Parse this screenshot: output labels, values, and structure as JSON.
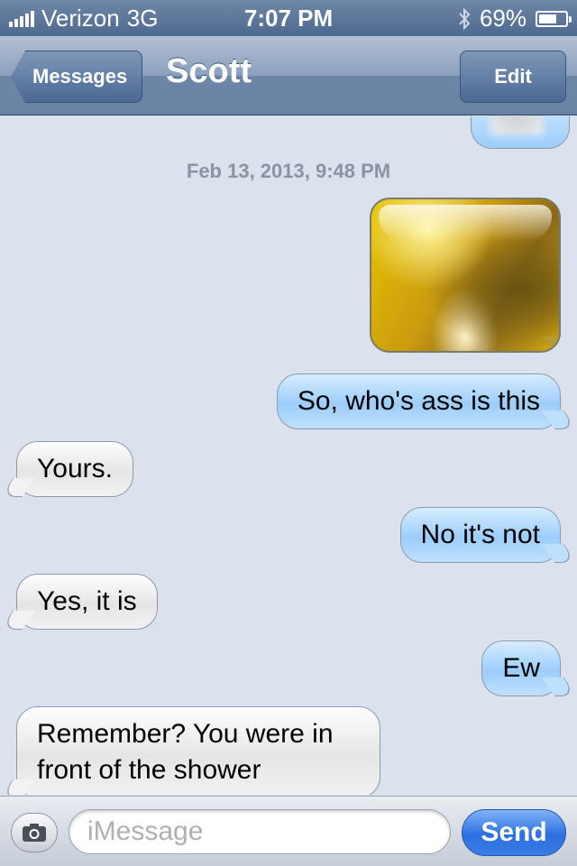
{
  "status_bar": {
    "carrier": "Verizon",
    "network": "3G",
    "time": "7:07 PM",
    "battery": "69%",
    "battery_level": 0.69,
    "icons": [
      "signal-icon",
      "bluetooth-icon",
      "battery-icon"
    ]
  },
  "nav": {
    "back_label": "Messages",
    "title": "Scott",
    "edit_label": "Edit"
  },
  "conversation": {
    "timestamp": "Feb 13, 2013, 9:48 PM",
    "messages": [
      {
        "direction": "outgoing",
        "type": "image"
      },
      {
        "direction": "outgoing",
        "type": "text",
        "text": "So, who's ass is this"
      },
      {
        "direction": "incoming",
        "type": "text",
        "text": "Yours."
      },
      {
        "direction": "outgoing",
        "type": "text",
        "text": "No it's not"
      },
      {
        "direction": "incoming",
        "type": "text",
        "text": "Yes, it is"
      },
      {
        "direction": "outgoing",
        "type": "text",
        "text": "Ew"
      },
      {
        "direction": "incoming",
        "type": "text",
        "text": "Remember? You were in front of the shower"
      }
    ]
  },
  "input_bar": {
    "placeholder": "iMessage",
    "value": "",
    "send_label": "Send"
  },
  "colors": {
    "outgoing_bubble": "#9ccdfb",
    "incoming_bubble": "#e5e5e5",
    "background": "#dbe2ed",
    "send_button": "#2d6fe0"
  }
}
